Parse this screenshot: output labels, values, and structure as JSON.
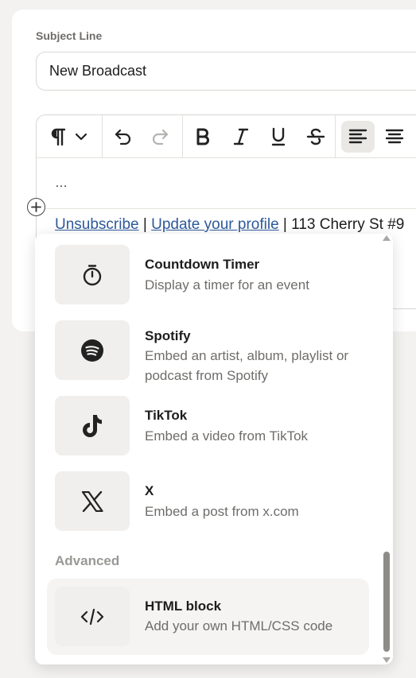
{
  "subject": {
    "label": "Subject Line",
    "value": "New Broadcast"
  },
  "toolbar": {
    "icons": [
      "paragraph-icon",
      "chevron-down-icon",
      "undo-icon",
      "redo-icon",
      "bold-icon",
      "italic-icon",
      "underline-icon",
      "strikethrough-icon",
      "align-left-icon",
      "align-center-icon"
    ],
    "active": "align-left-icon"
  },
  "editor": {
    "ellipsis": "…",
    "footer": {
      "unsubscribe": "Unsubscribe",
      "sep1": " | ",
      "update_profile": "Update your profile",
      "sep2": " | ",
      "address": "113 Cherry St #9"
    }
  },
  "menu": {
    "items": [
      {
        "title": "Countdown Timer",
        "desc": "Display a timer for an event",
        "icon": "stopwatch-icon"
      },
      {
        "title": "Spotify",
        "desc": "Embed an artist, album, playlist or podcast from Spotify",
        "icon": "spotify-icon"
      },
      {
        "title": "TikTok",
        "desc": "Embed a video from TikTok",
        "icon": "tiktok-icon"
      },
      {
        "title": "X",
        "desc": "Embed a post from x.com",
        "icon": "x-logo-icon"
      }
    ],
    "advanced_label": "Advanced",
    "advanced": [
      {
        "title": "HTML block",
        "desc": "Add your own HTML/CSS code",
        "icon": "code-icon",
        "selected": true
      }
    ]
  },
  "colors": {
    "link": "#2e5a9a",
    "muted": "#6f6d6a",
    "tile": "#f0efed"
  }
}
